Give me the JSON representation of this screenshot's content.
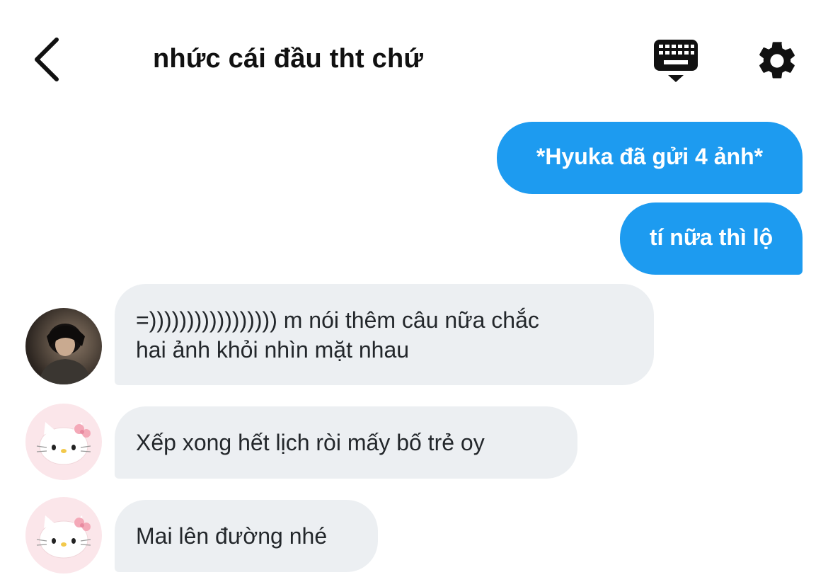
{
  "header": {
    "title": "nhức cái đầu tht chứ",
    "back_icon": "chevron-left-icon",
    "keyboard_icon": "keyboard-icon",
    "settings_icon": "gear-icon"
  },
  "messages": {
    "sent_1": "*Hyuka đã gửi 4 ảnh*",
    "sent_2": "tí nữa thì lộ",
    "recv_1_line1": "=))))))))))))))))) m nói thêm câu nữa chắc",
    "recv_1_line2": "hai ảnh khỏi nhìn mặt nhau",
    "recv_2": "Xếp xong hết lịch ròi mấy bố trẻ oy",
    "recv_3": "Mai lên đường nhé"
  },
  "colors": {
    "sent_bubble": "#1d9bf0",
    "received_bubble": "#eceff2",
    "avatar_kitty_bg": "#fbe6ea"
  }
}
